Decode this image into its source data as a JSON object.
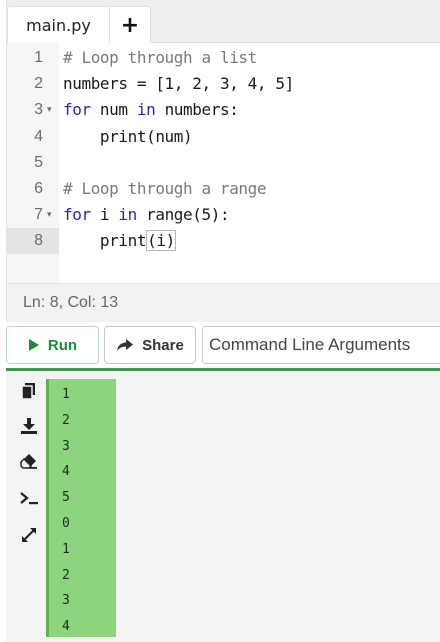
{
  "editor": {
    "tab_label": "main.py",
    "add_tab_label": "+",
    "lines": [
      {
        "num": "1",
        "fold": "",
        "segments": [
          {
            "text": "# Loop through a list",
            "cls": "cm"
          }
        ]
      },
      {
        "num": "2",
        "fold": "",
        "segments": [
          {
            "text": "numbers = [1, 2, 3, 4, 5]",
            "cls": ""
          }
        ]
      },
      {
        "num": "3",
        "fold": "▾",
        "segments": [
          {
            "text": "for",
            "cls": "kw"
          },
          {
            "text": " num ",
            "cls": ""
          },
          {
            "text": "in",
            "cls": "kw"
          },
          {
            "text": " numbers:",
            "cls": ""
          }
        ]
      },
      {
        "num": "4",
        "fold": "",
        "segments": [
          {
            "text": "    print(num)",
            "cls": ""
          }
        ]
      },
      {
        "num": "5",
        "fold": "",
        "segments": [
          {
            "text": "",
            "cls": ""
          }
        ]
      },
      {
        "num": "6",
        "fold": "",
        "segments": [
          {
            "text": "# Loop through a range",
            "cls": "cm"
          }
        ]
      },
      {
        "num": "7",
        "fold": "▾",
        "segments": [
          {
            "text": "for",
            "cls": "kw"
          },
          {
            "text": " i ",
            "cls": ""
          },
          {
            "text": "in",
            "cls": "kw"
          },
          {
            "text": " range(5):",
            "cls": ""
          }
        ]
      },
      {
        "num": "8",
        "fold": "",
        "segments": [
          {
            "text": "    print",
            "cls": ""
          },
          {
            "text": "(i)",
            "cls": "bracket-box"
          }
        ]
      }
    ],
    "active_line": 8,
    "status": "Ln: 8,  Col: 13"
  },
  "toolbar": {
    "run_label": "Run",
    "share_label": "Share",
    "args_placeholder": "Command Line Arguments"
  },
  "output": {
    "side_icons": [
      "copy-icon",
      "download-icon",
      "eraser-icon",
      "terminal-icon",
      "expand-icon"
    ],
    "lines": [
      "1",
      "2",
      "3",
      "4",
      "5",
      "0",
      "1",
      "2",
      "3",
      "4"
    ]
  },
  "colors": {
    "accent_green": "#3c9c4c",
    "output_highlight": "#8cd47e",
    "keyword": "#2a2aa8",
    "comment": "#7a7a7a"
  }
}
